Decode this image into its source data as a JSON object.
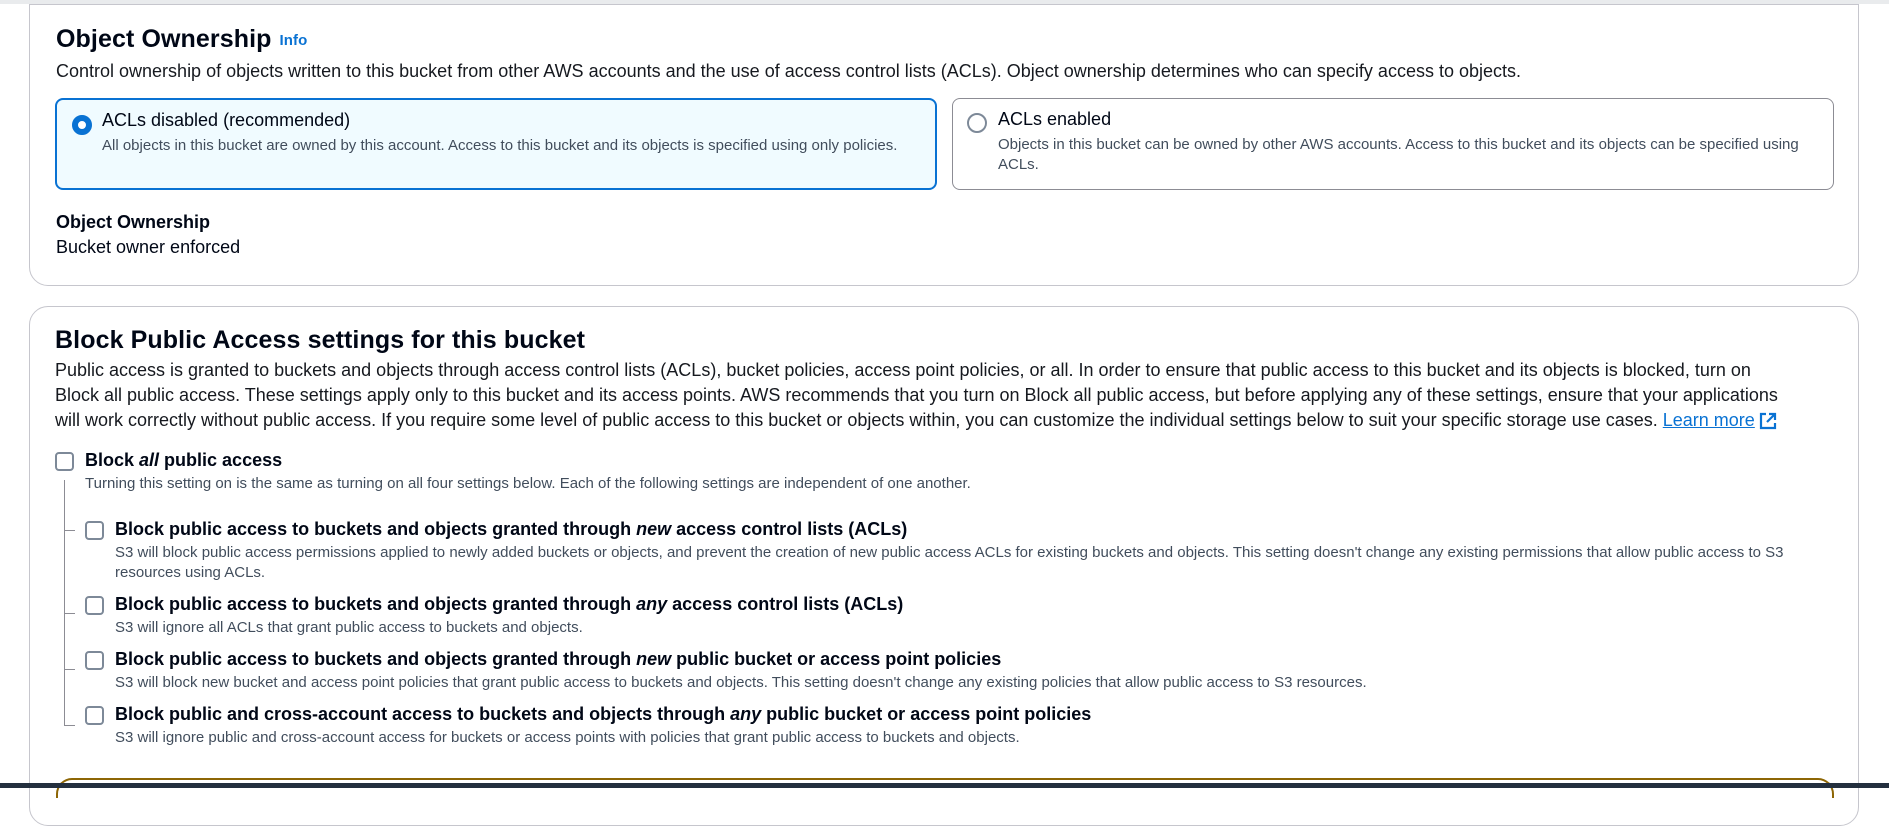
{
  "object_ownership": {
    "title": "Object Ownership",
    "info_link": "Info",
    "description": "Control ownership of objects written to this bucket from other AWS accounts and the use of access control lists (ACLs). Object ownership determines who can specify access to objects.",
    "options": [
      {
        "label": "ACLs disabled (recommended)",
        "description": "All objects in this bucket are owned by this account. Access to this bucket and its objects is specified using only policies.",
        "selected": true
      },
      {
        "label": "ACLs enabled",
        "description": "Objects in this bucket can be owned by other AWS accounts. Access to this bucket and its objects can be specified using ACLs.",
        "selected": false
      }
    ],
    "ownership_label": "Object Ownership",
    "ownership_value": "Bucket owner enforced"
  },
  "block_public_access": {
    "title": "Block Public Access settings for this bucket",
    "description": "Public access is granted to buckets and objects through access control lists (ACLs), bucket policies, access point policies, or all. In order to ensure that public access to this bucket and its objects is blocked, turn on Block all public access. These settings apply only to this bucket and its access points. AWS recommends that you turn on Block all public access, but before applying any of these settings, ensure that your applications will work correctly without public access. If you require some level of public access to this bucket or objects within, you can customize the individual settings below to suit your specific storage use cases.",
    "learn_more": "Learn more",
    "block_all": {
      "label_pre": "Block ",
      "label_em": "all",
      "label_post": " public access",
      "description": "Turning this setting on is the same as turning on all four settings below. Each of the following settings are independent of one another.",
      "checked": false
    },
    "settings": [
      {
        "label_pre": "Block public access to buckets and objects granted through ",
        "label_em": "new",
        "label_post": " access control lists (ACLs)",
        "description": "S3 will block public access permissions applied to newly added buckets or objects, and prevent the creation of new public access ACLs for existing buckets and objects. This setting doesn't change any existing permissions that allow public access to S3 resources using ACLs.",
        "checked": false
      },
      {
        "label_pre": "Block public access to buckets and objects granted through ",
        "label_em": "any",
        "label_post": " access control lists (ACLs)",
        "description": "S3 will ignore all ACLs that grant public access to buckets and objects.",
        "checked": false
      },
      {
        "label_pre": "Block public access to buckets and objects granted through ",
        "label_em": "new",
        "label_post": " public bucket or access point policies",
        "description": "S3 will block new bucket and access point policies that grant public access to buckets and objects. This setting doesn't change any existing policies that allow public access to S3 resources.",
        "checked": false
      },
      {
        "label_pre": "Block public and cross-account access to buckets and objects through ",
        "label_em": "any",
        "label_post": " public bucket or access point policies",
        "description": "S3 will ignore public and cross-account access for buckets or access points with policies that grant public access to buckets and objects.",
        "checked": false
      }
    ]
  },
  "colors": {
    "accent": "#0972d3",
    "selected_tile_bg": "#f0fbff",
    "text": "#000716",
    "secondary_text": "#414d5c",
    "border": "#c6c6cd",
    "warning_border": "#8d6605"
  },
  "icons": {
    "external_link": "external-link-icon",
    "radio_selected": "radio-selected-icon",
    "radio_unselected": "radio-unselected-icon"
  }
}
